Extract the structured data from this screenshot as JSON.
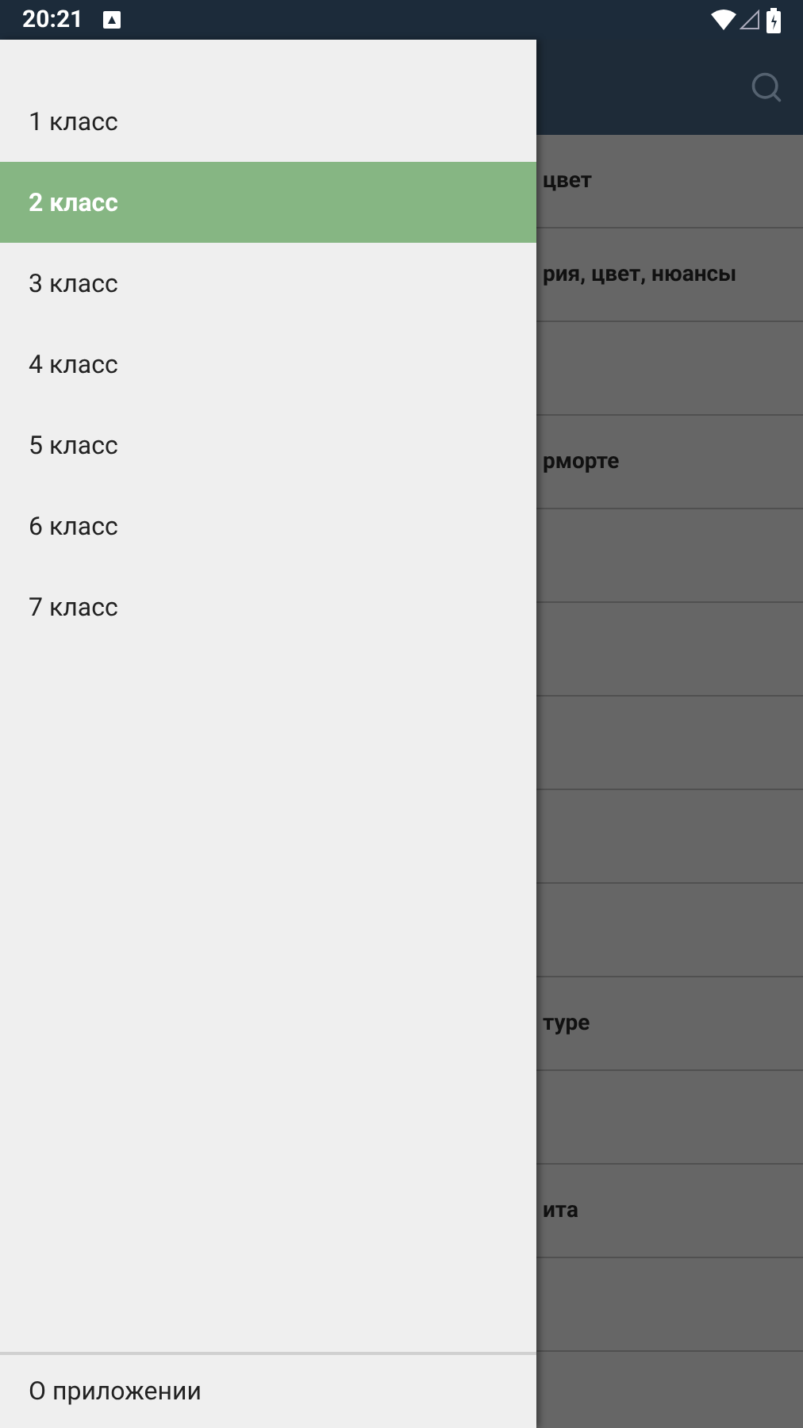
{
  "status_bar": {
    "time": "20:21"
  },
  "drawer": {
    "items": [
      {
        "label": "1 класс",
        "selected": false
      },
      {
        "label": "2 класс",
        "selected": true
      },
      {
        "label": "3 класс",
        "selected": false
      },
      {
        "label": "4 класс",
        "selected": false
      },
      {
        "label": "5 класс",
        "selected": false
      },
      {
        "label": "6 класс",
        "selected": false
      },
      {
        "label": "7 класс",
        "selected": false
      }
    ],
    "footer": "О приложении"
  },
  "list": {
    "rows": [
      "цвет",
      "рия, цвет, нюансы",
      "",
      "рморте",
      "",
      "",
      "",
      "",
      "",
      "туре",
      "",
      "ита",
      "",
      ""
    ]
  }
}
